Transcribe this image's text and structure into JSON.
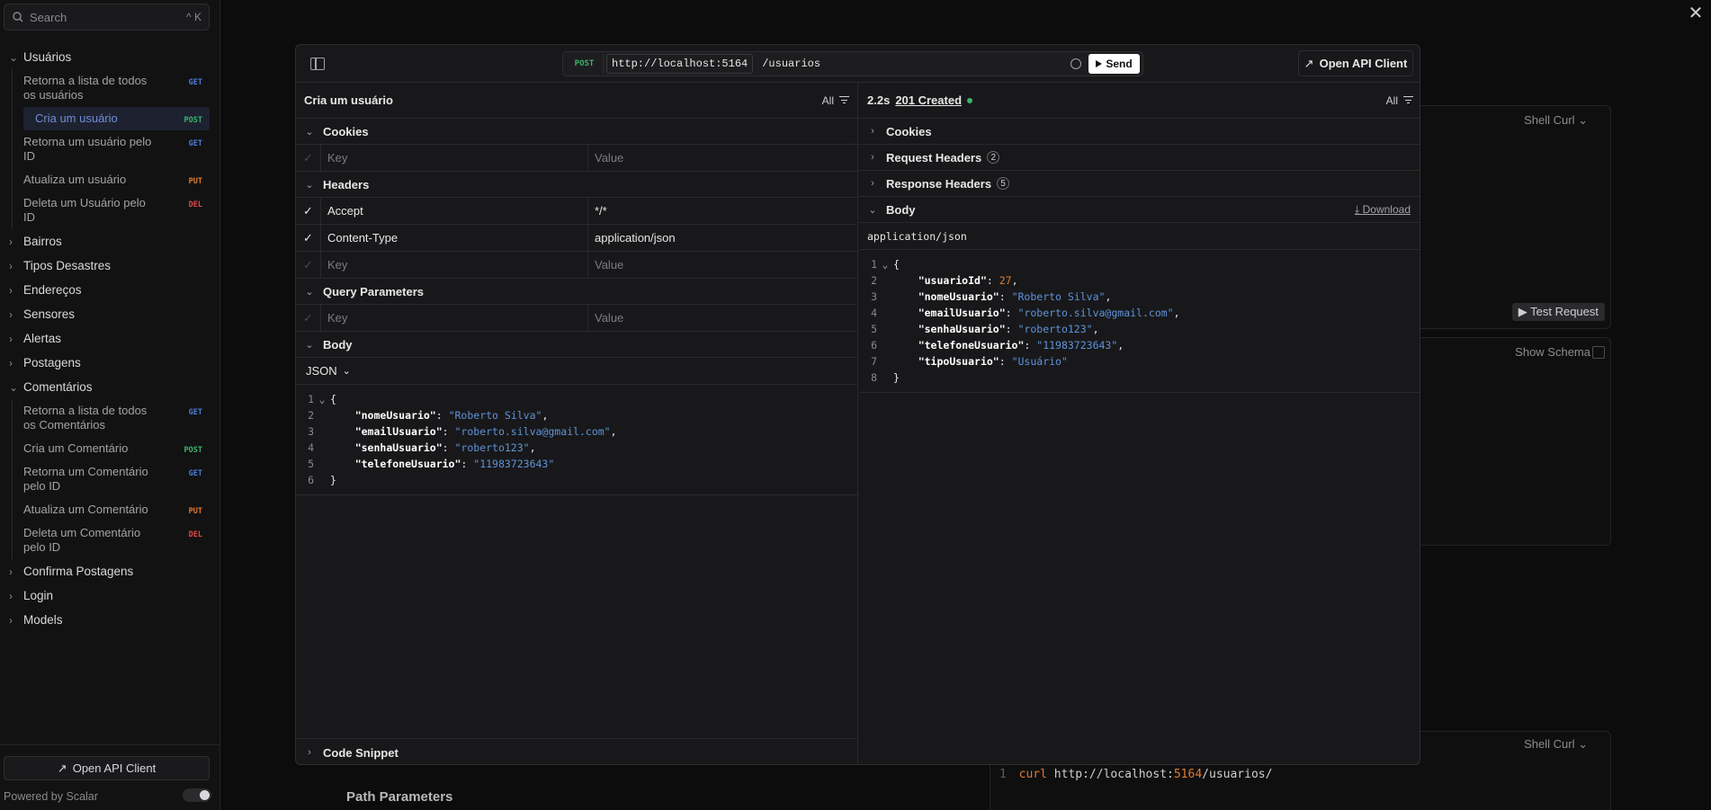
{
  "sidebar": {
    "search_placeholder": "Search",
    "search_shortcut": "^ K",
    "groups": [
      {
        "label": "Usuários",
        "expanded": true,
        "items": [
          {
            "label": "Retorna a lista de todos os usuários",
            "method": "GET"
          },
          {
            "label": "Cria um usuário",
            "method": "POST",
            "active": true
          },
          {
            "label": "Retorna um usuário pelo ID",
            "method": "GET"
          },
          {
            "label": "Atualiza um usuário",
            "method": "PUT"
          },
          {
            "label": "Deleta um Usuário pelo ID",
            "method": "DEL"
          }
        ]
      },
      {
        "label": "Bairros"
      },
      {
        "label": "Tipos Desastres"
      },
      {
        "label": "Endereços"
      },
      {
        "label": "Sensores"
      },
      {
        "label": "Alertas"
      },
      {
        "label": "Postagens"
      },
      {
        "label": "Comentários",
        "expanded": true,
        "items": [
          {
            "label": "Retorna a lista de todos os Comentários",
            "method": "GET"
          },
          {
            "label": "Cria um Comentário",
            "method": "POST"
          },
          {
            "label": "Retorna um Comentário pelo ID",
            "method": "GET"
          },
          {
            "label": "Atualiza um Comentário",
            "method": "PUT"
          },
          {
            "label": "Deleta um Comentário pelo ID",
            "method": "DEL"
          }
        ]
      },
      {
        "label": "Confirma Postagens"
      },
      {
        "label": "Login"
      },
      {
        "label": "Models"
      }
    ],
    "open_client": "Open API Client",
    "powered_by": "Powered by Scalar"
  },
  "background": {
    "shell_curl_1": "Shell Curl",
    "test_request": "Test Request",
    "show_schema": "Show Schema",
    "shell_curl_2": "Shell Curl",
    "curl_line_num": "1",
    "curl_cmd": "curl",
    "curl_url_a": "http://localhost:",
    "curl_url_port": "5164",
    "curl_url_b": "/usuarios/",
    "path_parameters": "Path Parameters"
  },
  "modal": {
    "method": "POST",
    "host": "http://localhost:5164",
    "path": "/usuarios",
    "send": "Send",
    "open_client": "Open API Client",
    "request": {
      "title": "Cria um usuário",
      "filter": "All",
      "cookies_label": "Cookies",
      "headers_label": "Headers",
      "query_label": "Query Parameters",
      "body_label": "Body",
      "key_placeholder": "Key",
      "value_placeholder": "Value",
      "headers": [
        {
          "key": "Accept",
          "value": "*/*"
        },
        {
          "key": "Content-Type",
          "value": "application/json"
        }
      ],
      "body_type": "JSON",
      "body_lines": [
        "{",
        "    \"nomeUsuario\": \"Roberto Silva\",",
        "    \"emailUsuario\": \"roberto.silva@gmail.com\",",
        "    \"senhaUsuario\": \"roberto123\",",
        "    \"telefoneUsuario\": \"11983723643\"",
        "}"
      ],
      "code_snippet": "Code Snippet"
    },
    "response": {
      "time": "2.2s",
      "status": "201 Created",
      "filter": "All",
      "cookies_label": "Cookies",
      "request_headers_label": "Request Headers",
      "request_headers_count": "2",
      "response_headers_label": "Response Headers",
      "response_headers_count": "5",
      "body_label": "Body",
      "download": "Download",
      "mime": "application/json",
      "body_lines": [
        "{",
        "    \"usuarioId\": 27,",
        "    \"nomeUsuario\": \"Roberto Silva\",",
        "    \"emailUsuario\": \"roberto.silva@gmail.com\",",
        "    \"senhaUsuario\": \"roberto123\",",
        "    \"telefoneUsuario\": \"11983723643\",",
        "    \"tipoUsuario\": \"Usuário\"",
        "}"
      ]
    }
  },
  "colors": {
    "get": "#4c7dd3",
    "post": "#3bb36c",
    "put": "#e07a2f",
    "del": "#e04747"
  }
}
